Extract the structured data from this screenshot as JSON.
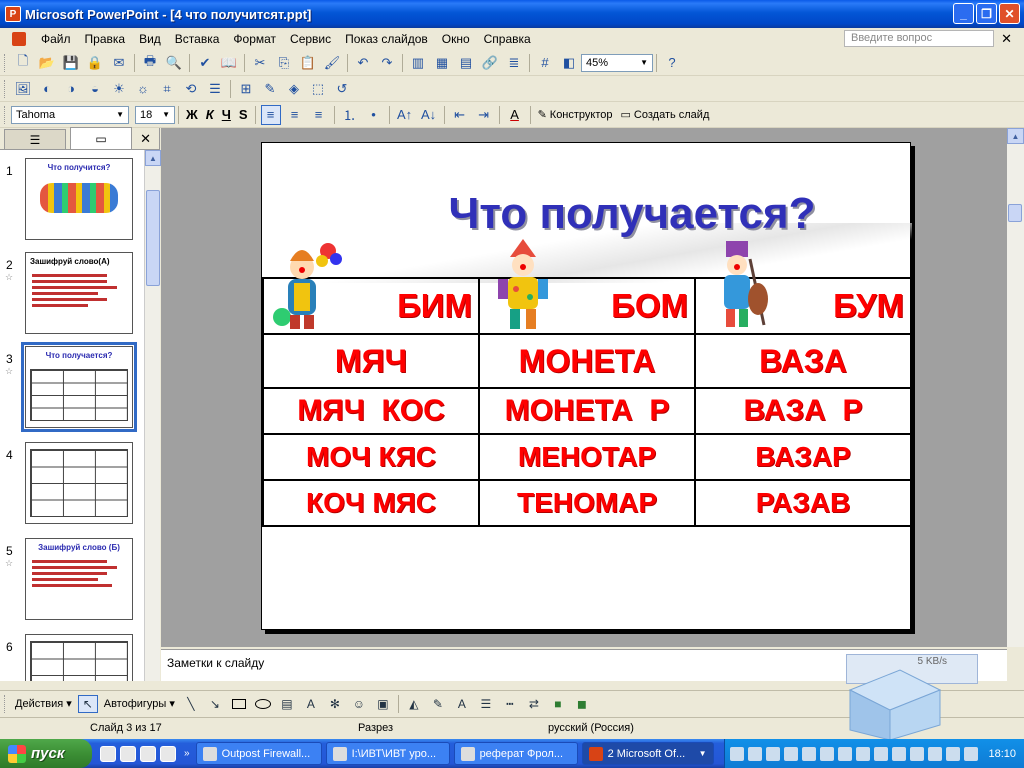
{
  "window": {
    "title": "Microsoft PowerPoint - [4 что получитсят.ppt]",
    "app_icon_letter": "P"
  },
  "menu": {
    "items": [
      "Файл",
      "Правка",
      "Вид",
      "Вставка",
      "Формат",
      "Сервис",
      "Показ слайдов",
      "Окно",
      "Справка"
    ],
    "help_placeholder": "Введите вопрос"
  },
  "toolbar": {
    "zoom": "45%",
    "font": "Tahoma",
    "size": "18",
    "bold": "Ж",
    "italic": "К",
    "underline": "Ч",
    "shadow": "S",
    "designer": "Конструктор",
    "new_slide": "Создать слайд"
  },
  "thumbnails": [
    {
      "num": "1",
      "title": "Что получится?"
    },
    {
      "num": "2",
      "title": "Зашифруй слово(А)"
    },
    {
      "num": "3",
      "title": "Что получается?"
    },
    {
      "num": "4",
      "title": ""
    },
    {
      "num": "5",
      "title": "Зашифруй слово (Б)"
    },
    {
      "num": "6",
      "title": ""
    }
  ],
  "slide": {
    "title": "Что получается?",
    "header": [
      "БИМ",
      "БОМ",
      "БУМ"
    ],
    "rows": [
      [
        "МЯЧ",
        "МОНЕТА",
        "ВАЗА"
      ],
      [
        "МЯЧ  КОС",
        "МОНЕТА  Р",
        "ВАЗА  Р"
      ],
      [
        "МОЧ КЯС",
        "МЕНОТАР",
        "ВАЗАР"
      ],
      [
        "КОЧ МЯС",
        "ТЕНОМАР",
        "РАЗАВ"
      ]
    ]
  },
  "notes": {
    "label": "Заметки к слайду"
  },
  "net": {
    "speed": "5 KB/s"
  },
  "drawing": {
    "actions": "Действия",
    "autoshapes": "Автофигуры"
  },
  "status": {
    "slide": "Слайд 3 из 17",
    "design": "Разрез",
    "language": "русский (Россия)"
  },
  "taskbar": {
    "start": "пуск",
    "tasks": [
      "Outpost Firewall...",
      "I:\\ИВТ\\ИВТ уро...",
      "реферат Фрол...",
      "2 Microsoft Of..."
    ],
    "clock": "18:10"
  }
}
